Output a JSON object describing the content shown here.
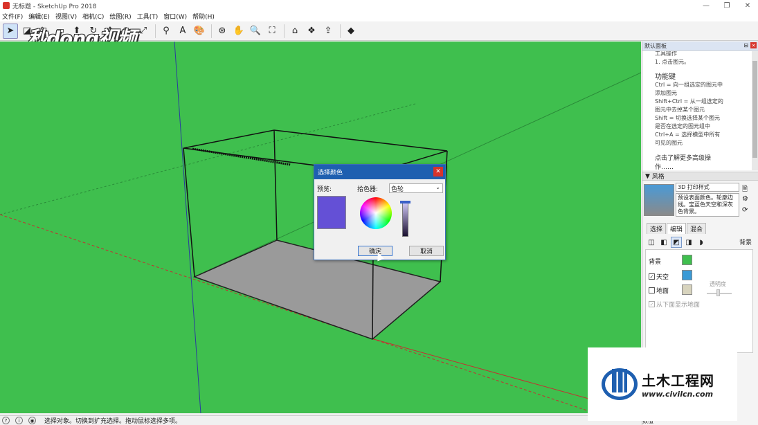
{
  "window": {
    "title": "无标题 - SketchUp Pro 2018",
    "controls": [
      "—",
      "❐",
      "✕"
    ]
  },
  "menu": [
    "文件(F)",
    "编辑(E)",
    "视图(V)",
    "相机(C)",
    "绘图(R)",
    "工具(T)",
    "窗口(W)",
    "帮助(H)"
  ],
  "toolbar": {
    "tools": [
      {
        "name": "select",
        "glyph": "➤"
      },
      {
        "name": "eraser",
        "glyph": "◪"
      },
      {
        "name": "pencil",
        "glyph": "✎"
      },
      {
        "name": "shapes",
        "glyph": "▭"
      },
      {
        "name": "pushpull",
        "glyph": "⬆"
      },
      {
        "name": "rotate",
        "glyph": "↻"
      },
      {
        "name": "move",
        "glyph": "✥"
      },
      {
        "name": "rotate2",
        "glyph": "⟳"
      },
      {
        "name": "scale",
        "glyph": "⤢"
      },
      {
        "name": "tape",
        "glyph": "⚲"
      },
      {
        "name": "text",
        "glyph": "A"
      },
      {
        "name": "paint",
        "glyph": "🎨"
      },
      {
        "name": "orbit",
        "glyph": "⊛"
      },
      {
        "name": "pan",
        "glyph": "✋"
      },
      {
        "name": "zoom",
        "glyph": "🔍"
      },
      {
        "name": "zoom-extents",
        "glyph": "⛶"
      },
      {
        "name": "warehouse",
        "glyph": "⌂"
      },
      {
        "name": "extension",
        "glyph": "❖"
      },
      {
        "name": "share",
        "glyph": "⇪"
      },
      {
        "name": "ruby",
        "glyph": "◆"
      }
    ],
    "watermark": "秒dong视频"
  },
  "dialog": {
    "title": "选择颜色",
    "preview_label": "预览:",
    "picker_label": "拾色器:",
    "picker_value": "色轮",
    "ok": "确定",
    "cancel": "取消",
    "preview_color": "#6450d6"
  },
  "panel": {
    "header": "默认面板",
    "instructor": {
      "cut_heading": "工具操作",
      "step": "1. 点击图元。",
      "func_heading": "功能键",
      "lines": [
        "Ctrl = 向一组选定的图元中",
        "添加图元",
        "Shift+Ctrl = 从一组选定的",
        "图元中去掉某个图元",
        "Shift = 切换选择某个图元",
        "是否在选定的图元组中",
        "Ctrl+A = 选择模型中所有",
        "可见的图元"
      ],
      "more": "点击了解更多高级操",
      "more2": "作……"
    },
    "styles": {
      "header": "风格",
      "name": "3D 打印样式",
      "desc": "预设表面颜色。轮廓边线。宝蓝色天空和深灰色背景。",
      "tabs": [
        "选择",
        "编辑",
        "混合"
      ],
      "active_tab": "编辑",
      "bg_label": "背景",
      "rows": {
        "background": "背景",
        "sky": "天空",
        "ground": "地面",
        "opacity": "透明度",
        "show_below": "从下面显示地面"
      },
      "colors": {
        "background": "#3fbf4e",
        "sky": "#3a9ad6",
        "ground": "#d8d4be"
      }
    }
  },
  "status": {
    "message": "选择对象。切换到扩充选择。拖动鼠标选择多项。",
    "measure_label": "数值"
  },
  "overlay": {
    "brand_cn": "土木工程网",
    "brand_url": "www.civilcn.com"
  }
}
